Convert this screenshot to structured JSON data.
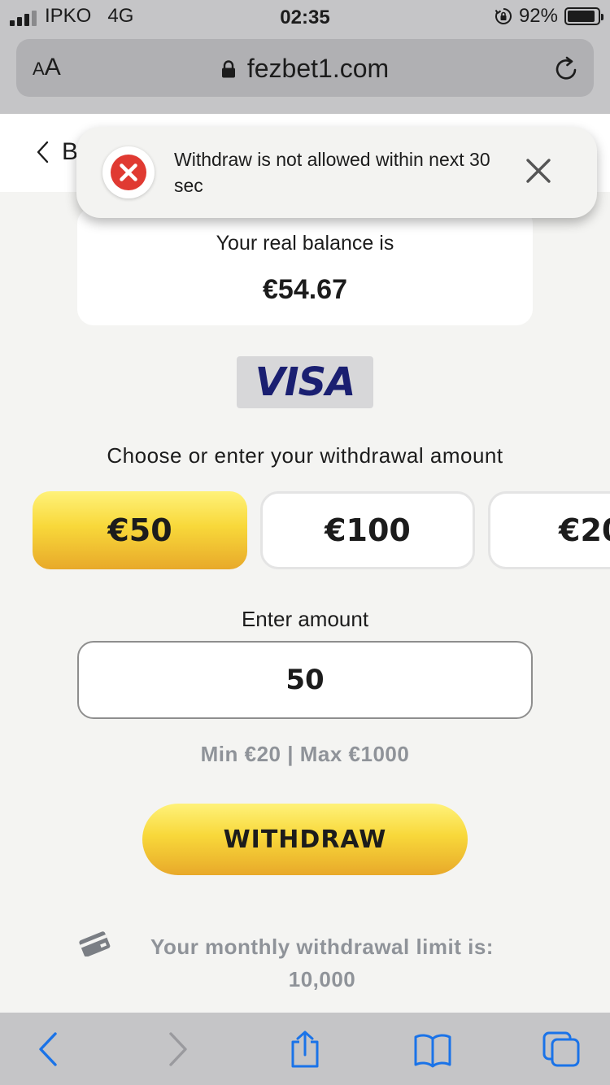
{
  "status_bar": {
    "carrier": "IPKO",
    "network": "4G",
    "time": "02:35",
    "battery_percent": "92%",
    "battery_level": 0.92
  },
  "browser": {
    "aa_label_small": "A",
    "aa_label_large": "A",
    "url": "fezbet1.com",
    "toolbar_icons": [
      "back-icon",
      "forward-icon",
      "share-icon",
      "bookmarks-icon",
      "tabs-icon"
    ]
  },
  "header": {
    "back_label": "B"
  },
  "toast": {
    "message": "Withdraw is not allowed within next 30 sec",
    "icon": "error-icon"
  },
  "balance": {
    "label": "Your real balance is",
    "value": "€54.67"
  },
  "payment_method": {
    "brand": "VISA"
  },
  "withdraw_form": {
    "choose_title": "Choose or enter your withdrawal amount",
    "preset_amounts": [
      "€50",
      "€100",
      "€20"
    ],
    "selected_index": 0,
    "enter_label": "Enter amount",
    "amount_value": "50",
    "min_max": "Min €20 | Max €1000",
    "submit_label": "WITHDRAW"
  },
  "limit": {
    "text": "Your monthly withdrawal limit is:",
    "value": "10,000"
  },
  "colors": {
    "accent_gradient_top": "#fff27a",
    "accent_gradient_bottom": "#e8a92a",
    "error_red": "#e03a32",
    "visa_blue": "#1a1f71",
    "muted_text": "#8f9399",
    "ios_tint": "#1a73e8"
  }
}
